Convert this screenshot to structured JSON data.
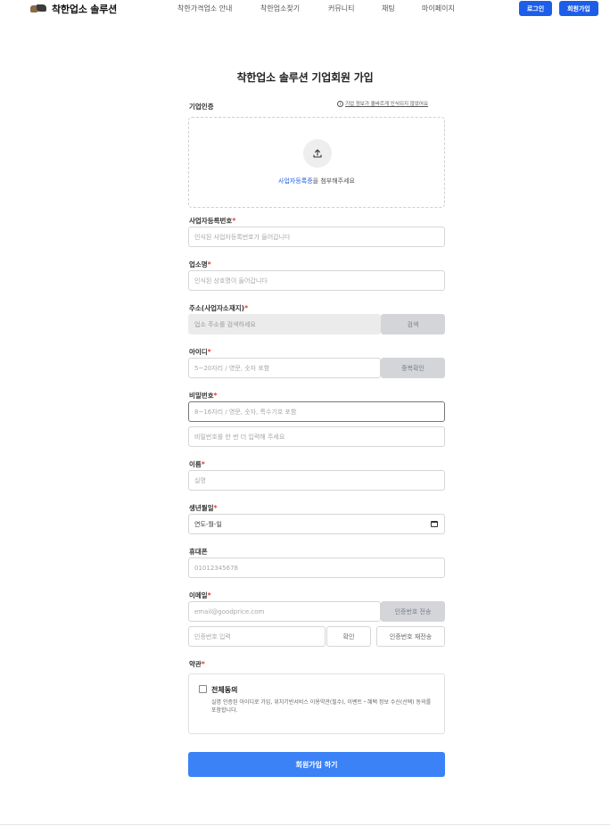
{
  "header": {
    "brand": "착한업소 솔루션",
    "nav": [
      "착한가격업소 안내",
      "착한업소찾기",
      "커뮤니티",
      "채팅",
      "마이페이지"
    ],
    "login": "로그인",
    "signup": "회원가입"
  },
  "form": {
    "title": "착한업소 솔루션 기업회원 가입",
    "cert_label": "기업인증",
    "cert_note": "기업 정보가 올바르게 인식되지 않았어요",
    "upload_link": "사업자등록증",
    "upload_text": "을 첨부해주세요",
    "biz_no_label": "사업자등록번호",
    "biz_no_placeholder": "인식된 사업자등록번호가 들어갑니다",
    "store_label": "업소명",
    "store_placeholder": "인식된 상호명이 들어갑니다",
    "address_label": "주소(사업자소재지)",
    "address_placeholder": "업소 주소를 검색하세요",
    "address_button": "검색",
    "id_label": "아이디",
    "id_placeholder": "5~20자리 / 영문, 숫자 포함",
    "id_button": "중복확인",
    "pw_label": "비밀번호",
    "pw_placeholder": "8~16자리 / 영문, 숫자, 특수기호 포함",
    "pw_confirm_placeholder": "비밀번호를 한 번 더 입력해 주세요",
    "name_label": "이름",
    "name_placeholder": "실명",
    "birth_label": "생년월일",
    "birth_value": "연도-월-일",
    "phone_label": "휴대폰",
    "phone_placeholder": "01012345678",
    "email_label": "이메일",
    "email_placeholder": "email@goodprice.com",
    "email_send_button": "인증번호 전송",
    "code_placeholder": "인증번호 입력",
    "code_confirm_button": "확인",
    "code_resend_button": "인증번호 재전송",
    "terms_label": "약관",
    "agree_all": "전체동의",
    "agree_desc": "실명 인증된 아이디로 가입, 위치기반서비스 이용약관(필수), 이벤트・혜택 정보 수신(선택) 동의를 포함합니다.",
    "submit": "회원가입 하기",
    "required_mark": "*"
  },
  "colors": {
    "primary": "#1d5ee8",
    "submit": "#3b82f6",
    "required": "#e03b3b"
  }
}
